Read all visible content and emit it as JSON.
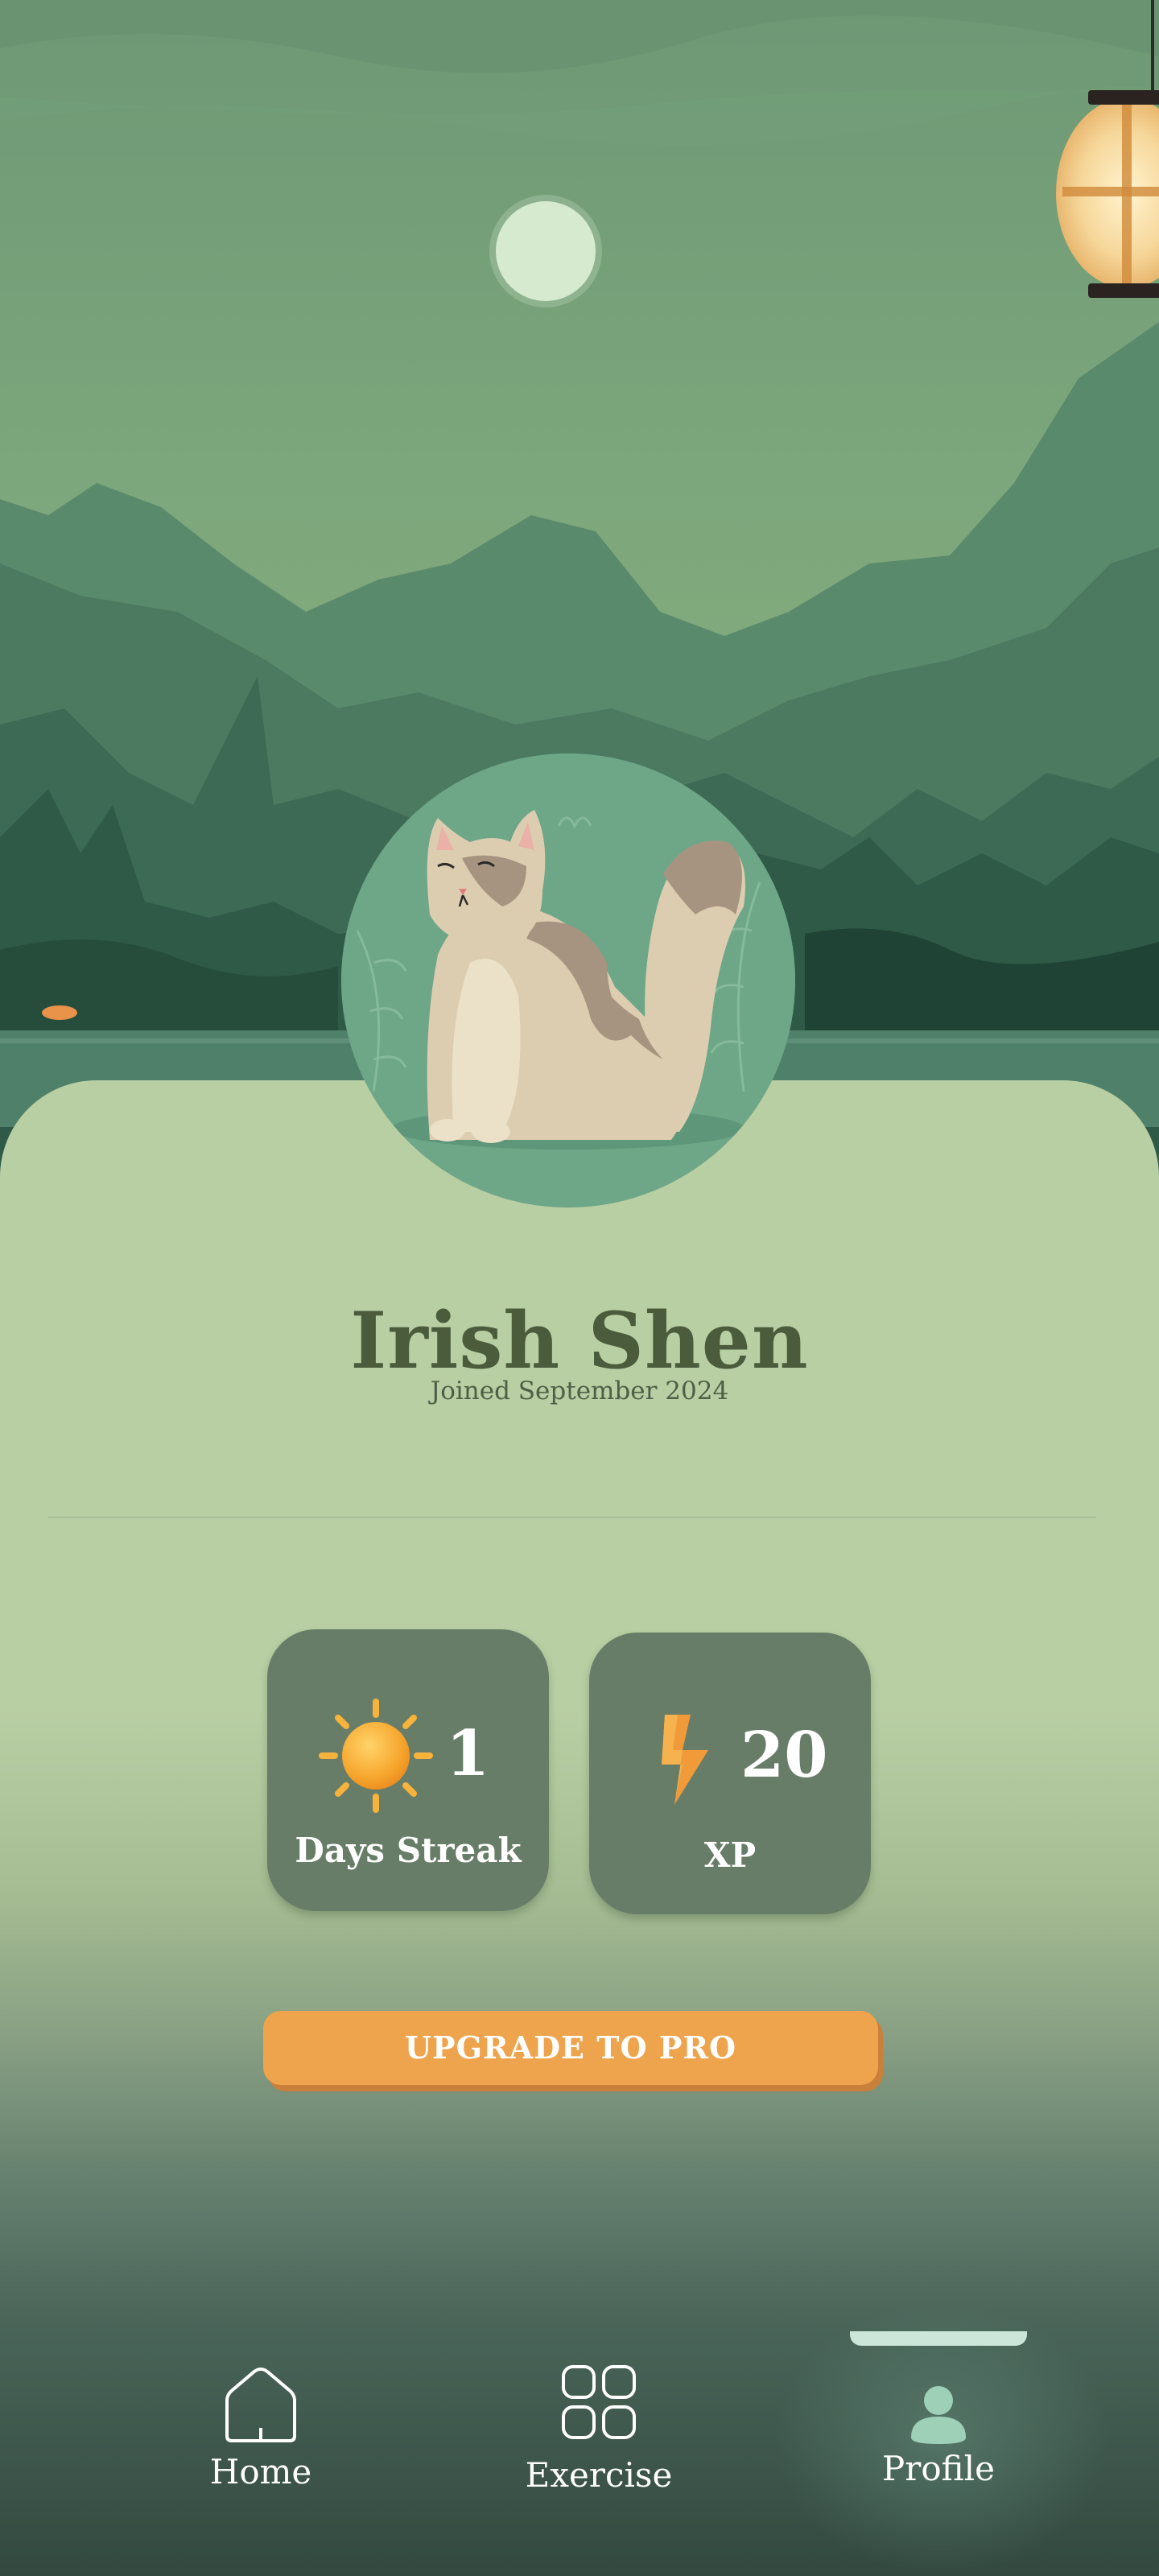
{
  "profile": {
    "name": "Irish Shen",
    "joined": "Joined September 2024",
    "avatar_icon": "cat-avatar-icon"
  },
  "stats": {
    "streak": {
      "value": "1",
      "label": "Days Streak",
      "icon": "sun-icon"
    },
    "xp": {
      "value": "20",
      "label": "XP",
      "icon": "lightning-icon"
    }
  },
  "cta": {
    "upgrade_label": "UPGRADE TO PRO"
  },
  "nav": {
    "items": [
      {
        "label": "Home",
        "icon": "home-icon"
      },
      {
        "label": "Exercise",
        "icon": "grid-icon"
      },
      {
        "label": "Profile",
        "icon": "person-icon",
        "active": true
      }
    ]
  },
  "colors": {
    "accent": "#eea44c",
    "title": "#4a5c3b",
    "card": "#677d67",
    "sheet": "#b8cea3"
  }
}
